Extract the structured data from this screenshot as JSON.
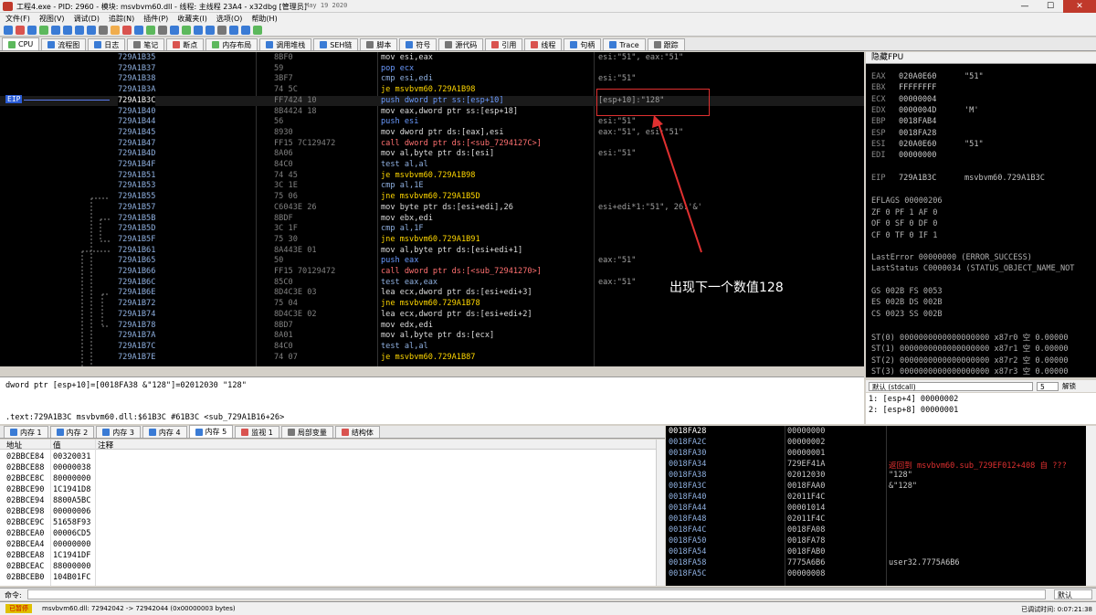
{
  "title": "工程4.exe - PID: 2960 - 模块: msvbvm60.dll - 线程: 主线程 23A4 - x32dbg [管理员]",
  "title_date": "May 19 2020",
  "menu": [
    "文件(F)",
    "视图(V)",
    "调试(D)",
    "追踪(N)",
    "插件(P)",
    "收藏夹(I)",
    "选项(O)",
    "帮助(H)"
  ],
  "tabs": [
    "CPU",
    "流程图",
    "日志",
    "笔记",
    "断点",
    "内存布局",
    "调用堆栈",
    "SEH链",
    "脚本",
    "符号",
    "源代码",
    "引用",
    "线程",
    "句柄",
    "Trace",
    "跟踪"
  ],
  "disasm": [
    {
      "addr": "729A1B35",
      "bytes": "8BF0",
      "instr": "mov esi,eax",
      "comment": "esi:\"51\", eax:\"51\""
    },
    {
      "addr": "729A1B37",
      "bytes": "59",
      "instr": "pop ecx",
      "comment": ""
    },
    {
      "addr": "729A1B38",
      "bytes": "3BF7",
      "instr": "cmp esi,edi",
      "comment": "esi:\"51\""
    },
    {
      "addr": "729A1B3A",
      "bytes": "74 5C",
      "instr": "je msvbvm60.729A1B98",
      "comment": ""
    },
    {
      "addr": "729A1B3C",
      "bytes": "FF7424 10",
      "instr": "push dword ptr ss:[esp+10]",
      "comment": "[esp+10]:\"128\""
    },
    {
      "addr": "729A1B40",
      "bytes": "8B4424 18",
      "instr": "mov eax,dword ptr ss:[esp+18]",
      "comment": ""
    },
    {
      "addr": "729A1B44",
      "bytes": "56",
      "instr": "push esi",
      "comment": "esi:\"51\""
    },
    {
      "addr": "729A1B45",
      "bytes": "8930",
      "instr": "mov dword ptr ds:[eax],esi",
      "comment": "eax:\"51\", esi:\"51\""
    },
    {
      "addr": "729A1B47",
      "bytes": "FF15 7C129472",
      "instr": "call dword ptr ds:[<sub_7294127C>]",
      "comment": ""
    },
    {
      "addr": "729A1B4D",
      "bytes": "8A06",
      "instr": "mov al,byte ptr ds:[esi]",
      "comment": "esi:\"51\""
    },
    {
      "addr": "729A1B4F",
      "bytes": "84C0",
      "instr": "test al,al",
      "comment": ""
    },
    {
      "addr": "729A1B51",
      "bytes": "74 45",
      "instr": "je msvbvm60.729A1B98",
      "comment": ""
    },
    {
      "addr": "729A1B53",
      "bytes": "3C 1E",
      "instr": "cmp al,1E",
      "comment": ""
    },
    {
      "addr": "729A1B55",
      "bytes": "75 06",
      "instr": "jne msvbvm60.729A1B5D",
      "comment": ""
    },
    {
      "addr": "729A1B57",
      "bytes": "C6043E 26",
      "instr": "mov byte ptr ds:[esi+edi],26",
      "comment": "esi+edi*1:\"51\", 26:'&'"
    },
    {
      "addr": "729A1B5B",
      "bytes": "8BDF",
      "instr": "mov ebx,edi",
      "comment": ""
    },
    {
      "addr": "729A1B5D",
      "bytes": "3C 1F",
      "instr": "cmp al,1F",
      "comment": ""
    },
    {
      "addr": "729A1B5F",
      "bytes": "75 30",
      "instr": "jne msvbvm60.729A1B91",
      "comment": ""
    },
    {
      "addr": "729A1B61",
      "bytes": "8A443E 01",
      "instr": "mov al,byte ptr ds:[esi+edi+1]",
      "comment": ""
    },
    {
      "addr": "729A1B65",
      "bytes": "50",
      "instr": "push eax",
      "comment": "eax:\"51\""
    },
    {
      "addr": "729A1B66",
      "bytes": "FF15 70129472",
      "instr": "call dword ptr ds:[<sub_72941270>]",
      "comment": ""
    },
    {
      "addr": "729A1B6C",
      "bytes": "85C0",
      "instr": "test eax,eax",
      "comment": "eax:\"51\""
    },
    {
      "addr": "729A1B6E",
      "bytes": "8D4C3E 03",
      "instr": "lea ecx,dword ptr ds:[esi+edi+3]",
      "comment": ""
    },
    {
      "addr": "729A1B72",
      "bytes": "75 04",
      "instr": "jne msvbvm60.729A1B78",
      "comment": ""
    },
    {
      "addr": "729A1B74",
      "bytes": "8D4C3E 02",
      "instr": "lea ecx,dword ptr ds:[esi+edi+2]",
      "comment": ""
    },
    {
      "addr": "729A1B78",
      "bytes": "8BD7",
      "instr": "mov edx,edi",
      "comment": ""
    },
    {
      "addr": "729A1B7A",
      "bytes": "8A01",
      "instr": "mov al,byte ptr ds:[ecx]",
      "comment": ""
    },
    {
      "addr": "729A1B7C",
      "bytes": "84C0",
      "instr": "test al,al",
      "comment": ""
    },
    {
      "addr": "729A1B7E",
      "bytes": "74 07",
      "instr": "je msvbvm60.729A1B87",
      "comment": ""
    }
  ],
  "eip_label": "EIP",
  "annotation": "出现下一个数值128",
  "registers_header": "隐藏FPU",
  "registers": [
    {
      "name": "EAX",
      "value": "020A0E60",
      "comment": "\"51\""
    },
    {
      "name": "EBX",
      "value": "FFFFFFFF",
      "comment": ""
    },
    {
      "name": "ECX",
      "value": "00000004",
      "comment": ""
    },
    {
      "name": "EDX",
      "value": "0000004D",
      "comment": "'M'"
    },
    {
      "name": "EBP",
      "value": "0018FAB4",
      "comment": ""
    },
    {
      "name": "ESP",
      "value": "0018FA28",
      "comment": ""
    },
    {
      "name": "ESI",
      "value": "020A0E60",
      "comment": "\"51\""
    },
    {
      "name": "EDI",
      "value": "00000000",
      "comment": ""
    }
  ],
  "eip_reg": {
    "name": "EIP",
    "value": "729A1B3C",
    "comment": "msvbvm60.729A1B3C"
  },
  "eflags": "EFLAGS   00000206",
  "flags": [
    "ZF 0  PF 1  AF 0",
    "OF 0  SF 0  DF 0",
    "CF 0  TF 0  IF 1"
  ],
  "last_error": "LastError  00000000 (ERROR_SUCCESS)",
  "last_status": "LastStatus C0000034 (STATUS_OBJECT_NAME_NOT",
  "segs": [
    "GS 002B  FS 0053",
    "ES 002B  DS 002B",
    "CS 0023  SS 002B"
  ],
  "fpu": [
    "ST(0) 0000000000000000000 x87r0 空 0.00000",
    "ST(1) 0000000000000000000 x87r1 空 0.00000",
    "ST(2) 0000000000000000000 x87r2 空 0.00000",
    "ST(3) 0000000000000000000 x87r3 空 0.00000"
  ],
  "info_lines": [
    "dword ptr [esp+10]=[0018FA38 &\"128\"]=02012030 \"128\"",
    ".text:729A1B3C msvbvm60.dll:$61B3C #61B3C <sub_729A1B16+26>"
  ],
  "callconv": "默认 (stdcall)",
  "argcount": "5",
  "unlock": "解锁",
  "stack_args": [
    "1: [esp+4] 00000002",
    "2: [esp+8] 00000001"
  ],
  "mem_tabs": [
    "内存 1",
    "内存 2",
    "内存 3",
    "内存 4",
    "内存 5",
    "监视 1",
    "局部变量",
    "结构体"
  ],
  "dump_headers": [
    "地址",
    "值",
    "注释"
  ],
  "dump_rows": [
    {
      "addr": "02BBCE84",
      "val": "00320031"
    },
    {
      "addr": "02BBCE88",
      "val": "00000038"
    },
    {
      "addr": "02BBCE8C",
      "val": "80000000"
    },
    {
      "addr": "02BBCE90",
      "val": "1C1941D8"
    },
    {
      "addr": "02BBCE94",
      "val": "8800A5BC"
    },
    {
      "addr": "02BBCE98",
      "val": "00000006"
    },
    {
      "addr": "02BBCE9C",
      "val": "51658F93"
    },
    {
      "addr": "02BBCEA0",
      "val": "00006CD5"
    },
    {
      "addr": "02BBCEA4",
      "val": "00000000"
    },
    {
      "addr": "02BBCEA8",
      "val": "1C1941DF"
    },
    {
      "addr": "02BBCEAC",
      "val": "88000000"
    },
    {
      "addr": "02BBCEB0",
      "val": "104B01FC"
    }
  ],
  "stack_rows": [
    {
      "addr": "0018FA28",
      "val": "00000000",
      "cm": ""
    },
    {
      "addr": "0018FA2C",
      "val": "00000002",
      "cm": ""
    },
    {
      "addr": "0018FA30",
      "val": "00000001",
      "cm": ""
    },
    {
      "addr": "0018FA34",
      "val": "729EF41A",
      "cm": "返回到 msvbvm60.sub_729EF012+408 自 ???"
    },
    {
      "addr": "0018FA38",
      "val": "02012030",
      "cm": "\"128\""
    },
    {
      "addr": "0018FA3C",
      "val": "0018FAA0",
      "cm": "&\"128\""
    },
    {
      "addr": "0018FA40",
      "val": "02011F4C",
      "cm": ""
    },
    {
      "addr": "0018FA44",
      "val": "00001014",
      "cm": ""
    },
    {
      "addr": "0018FA48",
      "val": "02011F4C",
      "cm": ""
    },
    {
      "addr": "0018FA4C",
      "val": "0018FA08",
      "cm": ""
    },
    {
      "addr": "0018FA50",
      "val": "0018FA78",
      "cm": ""
    },
    {
      "addr": "0018FA54",
      "val": "0018FAB0",
      "cm": ""
    },
    {
      "addr": "0018FA58",
      "val": "7775A6B6",
      "cm": "user32.7775A6B6"
    },
    {
      "addr": "0018FA5C",
      "val": "00000008",
      "cm": ""
    }
  ],
  "cmd_label": "命令:",
  "cmd_right": "默认",
  "status": {
    "state": "已暂停",
    "msg": "msvbvm60.dll: 72942042 -> 72942044 (0x00000003 bytes)",
    "time": "已调试时间: 0:07:21:38"
  }
}
